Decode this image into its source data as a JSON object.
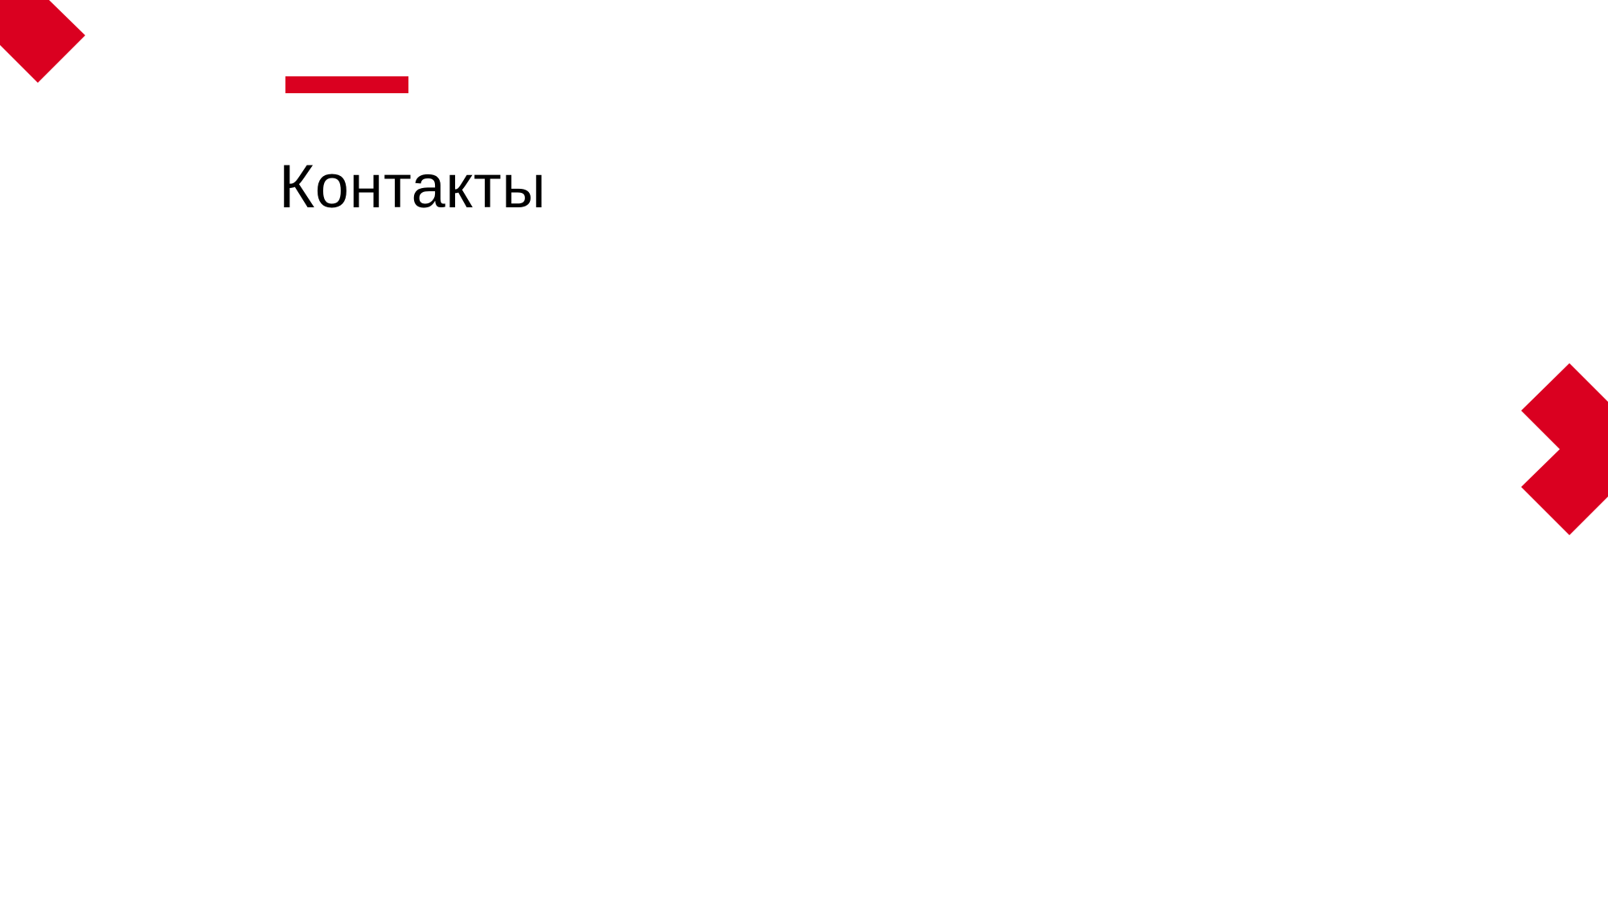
{
  "slide": {
    "title": "Контакты"
  },
  "colors": {
    "accent": "#DA0020",
    "text": "#000000",
    "background": "#FFFFFF"
  }
}
